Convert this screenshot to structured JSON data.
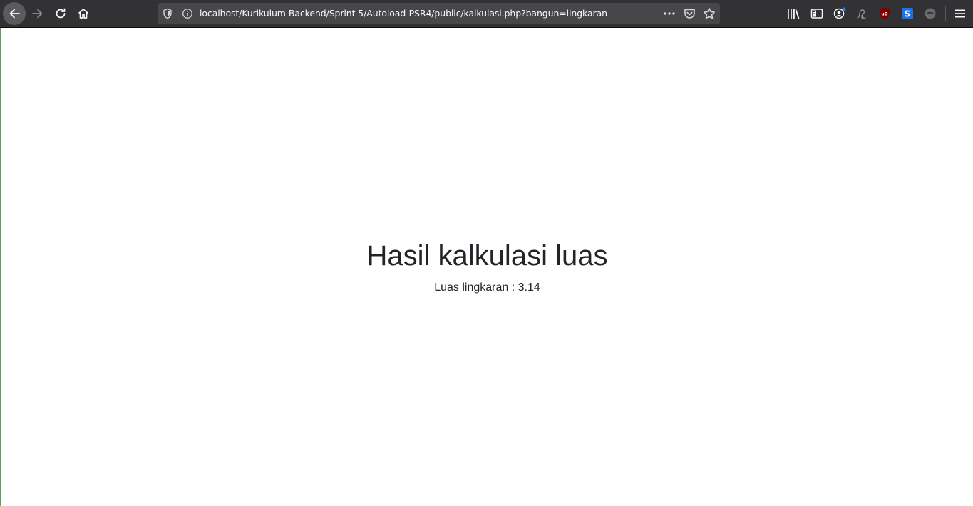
{
  "browser": {
    "address_bar": {
      "url": "localhost/Kurikulum-Backend/Sprint 5/Autoload-PSR4/public/kalkulasi.php?bangun=lingkaran"
    },
    "nav_icons": [
      "back-icon",
      "forward-icon",
      "reload-icon",
      "home-icon"
    ],
    "toolbar_icons": [
      "library-icon",
      "sidebar-icon",
      "account-icon",
      "extension-icon",
      "ublock-icon",
      "extension-s-icon",
      "extension-disabled-icon",
      "menu-icon"
    ],
    "colors": {
      "toolbar_bg": "#323234",
      "urlbar_bg": "#474749",
      "ublock_red": "#800000",
      "ext_blue": "#1a73e8",
      "account_badge": "#0a84ff"
    }
  },
  "page": {
    "heading": "Hasil kalkulasi luas",
    "result": "Luas lingkaran : 3.14"
  }
}
